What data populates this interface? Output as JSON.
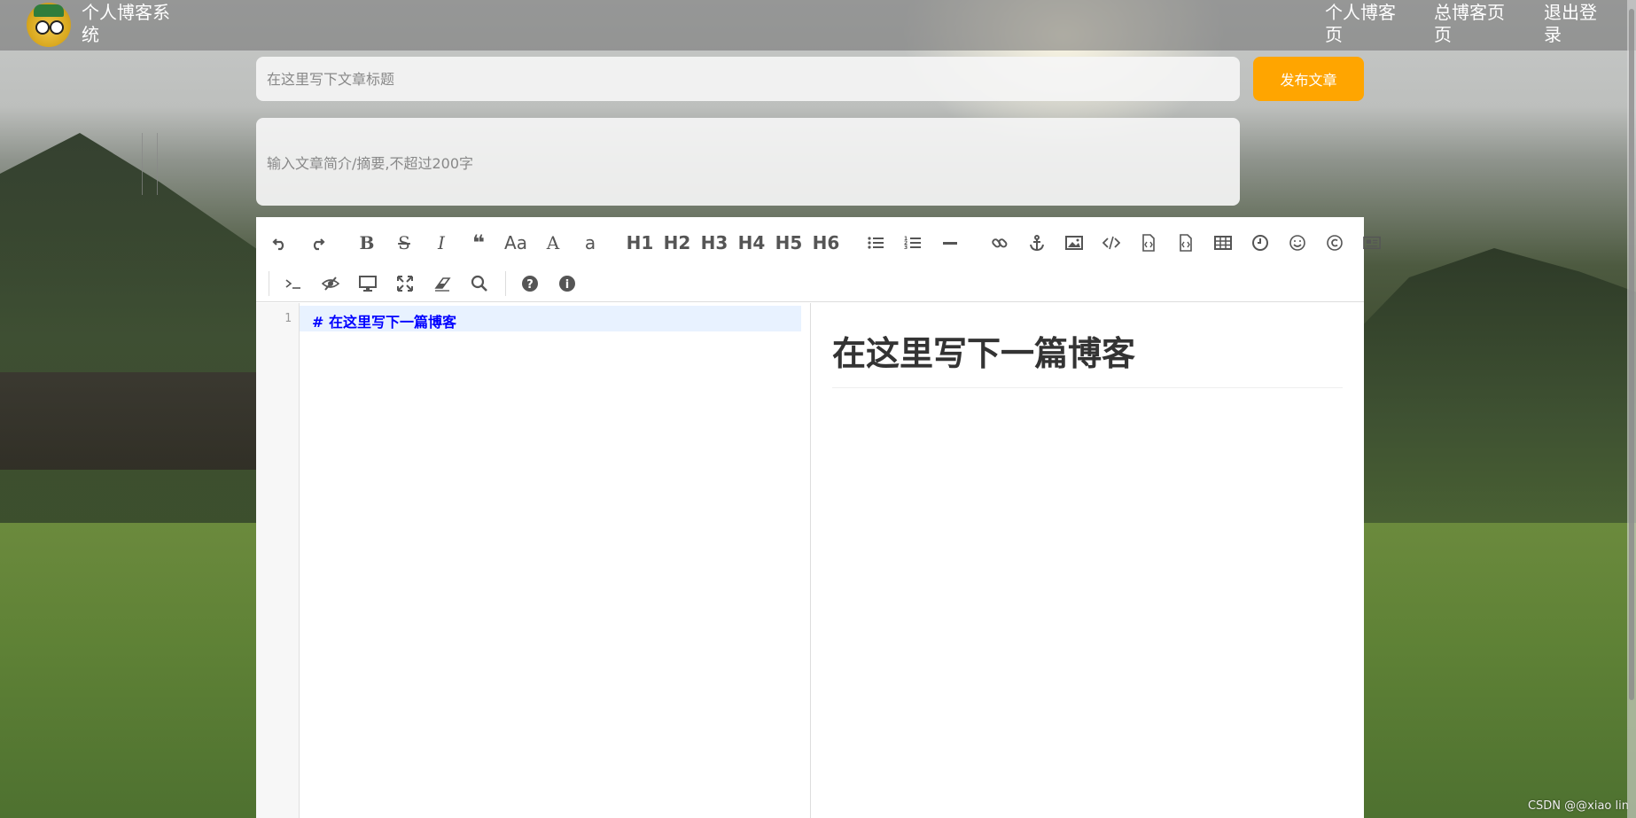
{
  "header": {
    "site_title": "个人博客系统",
    "nav": [
      {
        "label": "个人博客页"
      },
      {
        "label": "总博客页页"
      },
      {
        "label": "退出登录"
      }
    ]
  },
  "form": {
    "title_placeholder": "在这里写下文章标题",
    "summary_placeholder": "输入文章简介/摘要,不超过200字",
    "publish_label": "发布文章"
  },
  "toolbar": {
    "row1": [
      {
        "icon": "undo-icon"
      },
      {
        "icon": "redo-icon"
      },
      {
        "sep": true
      },
      {
        "icon": "bold-icon",
        "text": "B"
      },
      {
        "icon": "strikethrough-icon",
        "text": "S"
      },
      {
        "icon": "italic-icon",
        "text": "I"
      },
      {
        "icon": "quote-icon",
        "text": "❝"
      },
      {
        "icon": "uppercase-icon",
        "text": "Aa"
      },
      {
        "icon": "uppercase-a-icon",
        "text": "A"
      },
      {
        "icon": "lowercase-a-icon",
        "text": "a"
      },
      {
        "sep": true
      },
      {
        "icon": "h1-icon",
        "text": "H1"
      },
      {
        "icon": "h2-icon",
        "text": "H2"
      },
      {
        "icon": "h3-icon",
        "text": "H3"
      },
      {
        "icon": "h4-icon",
        "text": "H4"
      },
      {
        "icon": "h5-icon",
        "text": "H5"
      },
      {
        "icon": "h6-icon",
        "text": "H6"
      },
      {
        "sep": true
      },
      {
        "icon": "unordered-list-icon"
      },
      {
        "icon": "ordered-list-icon"
      },
      {
        "icon": "horizontal-rule-icon"
      },
      {
        "sep": true
      },
      {
        "icon": "link-icon"
      },
      {
        "icon": "anchor-icon"
      },
      {
        "icon": "image-icon"
      },
      {
        "icon": "code-icon"
      },
      {
        "icon": "code-block-icon"
      },
      {
        "icon": "file-code-icon"
      },
      {
        "icon": "table-icon"
      },
      {
        "icon": "clock-icon"
      },
      {
        "icon": "emoji-icon"
      },
      {
        "icon": "copyright-icon"
      },
      {
        "icon": "pagebreak-icon"
      }
    ],
    "row2": [
      {
        "icon": "terminal-icon"
      },
      {
        "icon": "eye-slash-icon"
      },
      {
        "icon": "desktop-icon"
      },
      {
        "icon": "fullscreen-icon"
      },
      {
        "icon": "eraser-icon"
      },
      {
        "icon": "search-icon"
      },
      {
        "sep": true
      },
      {
        "icon": "help-icon"
      },
      {
        "icon": "info-icon"
      }
    ]
  },
  "editor": {
    "line_number": "1",
    "code_line": "# 在这里写下一篇博客",
    "preview_heading": "在这里写下一篇博客"
  },
  "watermark": "CSDN @@xiao lin"
}
